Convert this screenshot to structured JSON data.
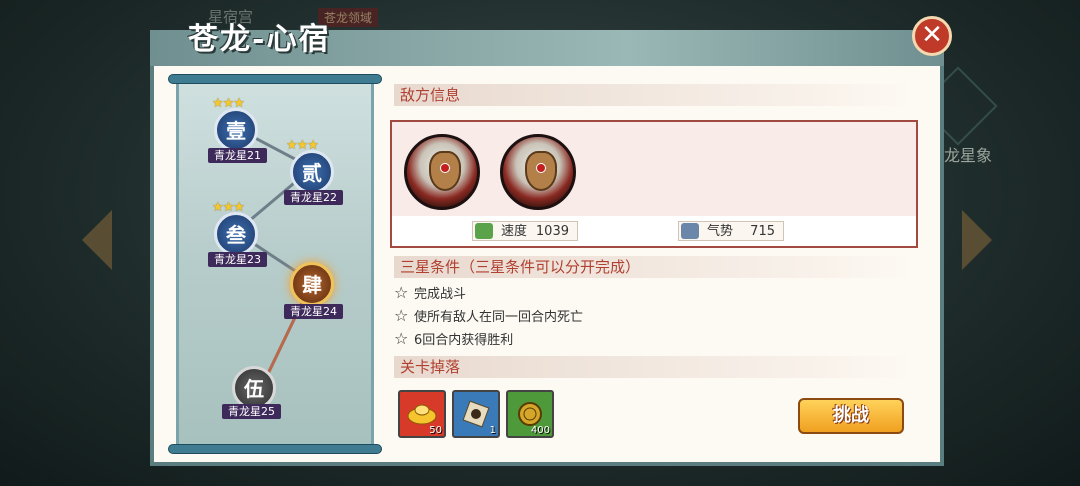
{
  "background": {
    "top_text": "星宿宫",
    "top_badge": "苍龙领域",
    "right_label": "苍龙星象"
  },
  "dialog": {
    "title": "苍龙-心宿",
    "close_label": "✕"
  },
  "stage_map": {
    "nodes": [
      {
        "numeral": "壹",
        "label": "青龙星21",
        "stars": "★★★",
        "state": "cleared"
      },
      {
        "numeral": "贰",
        "label": "青龙星22",
        "stars": "★★★",
        "state": "cleared"
      },
      {
        "numeral": "叁",
        "label": "青龙星23",
        "stars": "★★★",
        "state": "cleared"
      },
      {
        "numeral": "肆",
        "label": "青龙星24",
        "stars": "",
        "state": "current"
      },
      {
        "numeral": "伍",
        "label": "青龙星25",
        "stars": "",
        "state": "locked"
      }
    ]
  },
  "enemy_info": {
    "heading": "敌方信息",
    "enemies": [
      {
        "name": "enemy-1"
      },
      {
        "name": "enemy-2"
      }
    ],
    "speed": {
      "label": "速度",
      "value": "1039"
    },
    "momentum": {
      "label": "气势",
      "value": "715"
    }
  },
  "three_star": {
    "heading": "三星条件（三星条件可以分开完成）",
    "conditions": [
      {
        "icon": "☆",
        "text": "完成战斗"
      },
      {
        "icon": "☆",
        "text": "使所有敌人在同一回合内死亡"
      },
      {
        "icon": "☆",
        "text": "6回合内获得胜利"
      }
    ]
  },
  "drops": {
    "heading": "关卡掉落",
    "items": [
      {
        "icon": "gold-ingot-icon",
        "qty": "50",
        "color": "#d83a2a"
      },
      {
        "icon": "scroll-item-icon",
        "qty": "1",
        "color": "#3a7ab8"
      },
      {
        "icon": "coin-icon",
        "qty": "400",
        "color": "#4e9a3a"
      }
    ]
  },
  "challenge_button": "挑战"
}
